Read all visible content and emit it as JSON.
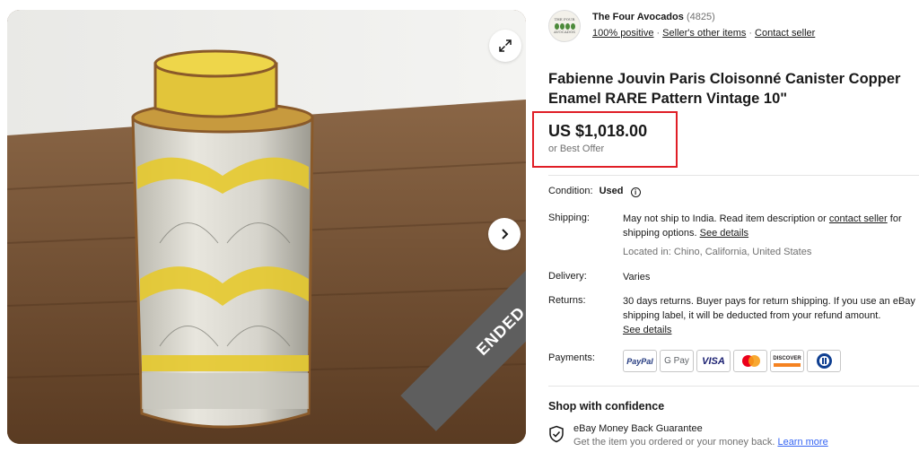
{
  "gallery": {
    "ended_label": "ENDED",
    "icons": {
      "expand": "expand-icon",
      "next": "chevron-right-icon"
    }
  },
  "seller": {
    "logo_text_top": "THE FOUR",
    "logo_text_bottom": "AVOCADOS",
    "name": "The Four Avocados",
    "feedback_count": "(4825)",
    "positive": "100% positive",
    "other_items": "Seller's other items",
    "contact": "Contact seller"
  },
  "listing": {
    "title": "Fabienne Jouvin Paris Cloisonné Canister Copper Enamel RARE Pattern Vintage 10\"",
    "price": "US $1,018.00",
    "best_offer": "or Best Offer",
    "highlight_color": "#e01e26"
  },
  "details": {
    "condition": {
      "label": "Condition:",
      "value": "Used"
    },
    "shipping": {
      "label": "Shipping:",
      "line1_pre": "May not ship to India. Read item description or ",
      "line1_link": "contact seller",
      "line1_post": " for",
      "line2_pre": "shipping options. ",
      "line2_link": "See details",
      "location": "Located in: Chino, California, United States"
    },
    "delivery": {
      "label": "Delivery:",
      "value": "Varies"
    },
    "returns": {
      "label": "Returns:",
      "line1": "30 days returns. Buyer pays for return shipping. If you use an eBay",
      "line2": "shipping label, it will be deducted from your refund amount.",
      "link": "See details"
    },
    "payments": {
      "label": "Payments:",
      "methods": [
        "PayPal",
        "G Pay",
        "VISA",
        "Mastercard",
        "DISCOVER",
        "Diners Club"
      ],
      "paypal": "PayPal",
      "gpay": "G Pay",
      "visa": "VISA",
      "discover": "DISCOVER"
    }
  },
  "confidence": {
    "title": "Shop with confidence",
    "guarantee_title": "eBay Money Back Guarantee",
    "guarantee_desc": "Get the item you ordered or your money back. ",
    "learn_more": "Learn more",
    "link_color": "#3665f3"
  }
}
